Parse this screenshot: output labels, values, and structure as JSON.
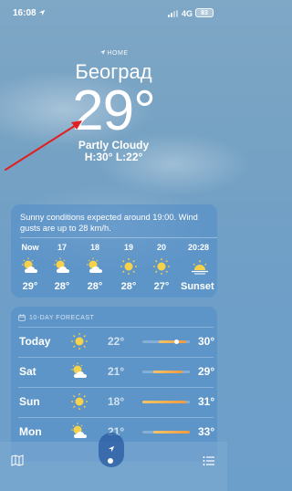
{
  "status": {
    "time": "16:08",
    "network": "4G",
    "battery": "83"
  },
  "header": {
    "home_label": "HOME",
    "city": "Београд",
    "temperature": "29°",
    "condition": "Partly Cloudy",
    "hilo": "H:30°  L:22°"
  },
  "hourly": {
    "summary": "Sunny conditions expected around 19:00. Wind gusts are up to 28 km/h.",
    "items": [
      {
        "time": "Now",
        "icon": "partly-sunny-icon",
        "temp": "29°"
      },
      {
        "time": "17",
        "icon": "partly-sunny-icon",
        "temp": "28°"
      },
      {
        "time": "18",
        "icon": "partly-sunny-icon",
        "temp": "28°"
      },
      {
        "time": "19",
        "icon": "sun-icon",
        "temp": "28°"
      },
      {
        "time": "20",
        "icon": "sun-icon",
        "temp": "27°"
      },
      {
        "time": "20:28",
        "icon": "sunset-icon",
        "temp": "Sunset"
      }
    ]
  },
  "forecast": {
    "title": "10-DAY FORECAST",
    "days": [
      {
        "day": "Today",
        "icon": "sun-icon",
        "low": "22°",
        "high": "30°"
      },
      {
        "day": "Sat",
        "icon": "partly-sunny-icon",
        "low": "21°",
        "high": "29°"
      },
      {
        "day": "Sun",
        "icon": "sun-icon",
        "low": "18°",
        "high": "31°"
      },
      {
        "day": "Mon",
        "icon": "partly-sunny-icon",
        "low": "21°",
        "high": "33°"
      }
    ]
  },
  "colors": {
    "sun": "#f6d14a",
    "accent_arrow": "#e02020",
    "range_warm": "#f29a3e"
  }
}
